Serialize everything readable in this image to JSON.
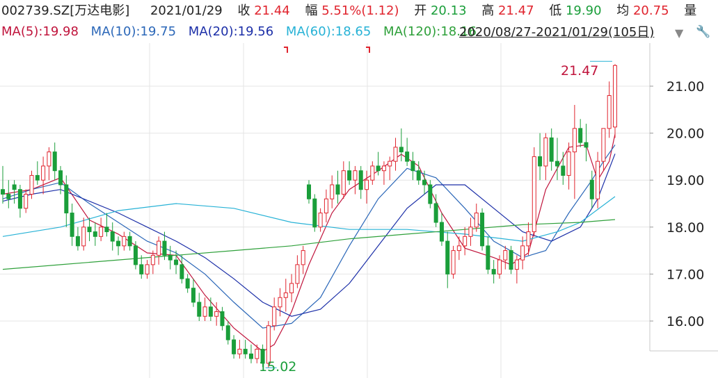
{
  "header": {
    "code": "002739.SZ[万达电影]",
    "date": "2021/01/29",
    "close_label": "收",
    "close_value": "21.44",
    "chg_label": "幅",
    "chg_value": "5.51%(1.12)",
    "open_label": "开",
    "open_value": "20.13",
    "high_label": "高",
    "high_value": "21.47",
    "low_label": "低",
    "low_value": "19.90",
    "avg_label": "均",
    "avg_value": "20.75",
    "vol_label": "量"
  },
  "ma_legend": [
    {
      "label": "MA(5): ",
      "value": "19.98",
      "color": "#c0143c"
    },
    {
      "label": "MA(10): ",
      "value": "19.75",
      "color": "#2b67b8"
    },
    {
      "label": "MA(20): ",
      "value": "19.56",
      "color": "#1c2fa8"
    },
    {
      "label": "MA(60): ",
      "value": "18.65",
      "color": "#27b2d6"
    },
    {
      "label": "MA(120): ",
      "value": "18.16",
      "color": "#2ea03a"
    }
  ],
  "range_text": "2020/08/27-2021/01/29(105日)",
  "chart_data": {
    "type": "candlestick",
    "y_ticks": [
      "21.00",
      "20.00",
      "19.00",
      "18.00",
      "17.00",
      "16.00"
    ],
    "ylim": [
      14.8,
      22.0
    ],
    "annotations": {
      "high_label": "21.47",
      "low_label": "15.02"
    },
    "colors": {
      "up": "#e0242e",
      "down": "#1a9e3a"
    },
    "ohlc": [
      [
        18.8,
        19.3,
        18.5,
        18.7
      ],
      [
        18.7,
        19.0,
        18.4,
        18.6
      ],
      [
        18.9,
        19.0,
        18.5,
        18.8
      ],
      [
        18.8,
        18.9,
        18.2,
        18.4
      ],
      [
        18.4,
        18.8,
        18.3,
        18.7
      ],
      [
        18.7,
        19.2,
        18.6,
        19.1
      ],
      [
        19.1,
        19.4,
        18.9,
        19.0
      ],
      [
        19.0,
        19.5,
        18.7,
        19.3
      ],
      [
        19.3,
        19.7,
        19.0,
        19.6
      ],
      [
        19.6,
        19.8,
        19.0,
        19.2
      ],
      [
        19.2,
        19.3,
        18.7,
        18.9
      ],
      [
        18.9,
        19.1,
        18.0,
        18.3
      ],
      [
        18.3,
        18.5,
        17.6,
        17.8
      ],
      [
        17.8,
        18.0,
        17.5,
        17.6
      ],
      [
        17.6,
        18.2,
        17.5,
        18.0
      ],
      [
        18.0,
        18.2,
        17.7,
        17.9
      ],
      [
        17.9,
        18.1,
        17.6,
        17.8
      ],
      [
        17.8,
        18.2,
        17.7,
        18.0
      ],
      [
        18.0,
        18.3,
        17.8,
        17.9
      ],
      [
        17.9,
        18.1,
        17.5,
        17.7
      ],
      [
        17.7,
        17.8,
        17.4,
        17.6
      ],
      [
        17.6,
        17.9,
        17.5,
        17.8
      ],
      [
        17.8,
        17.9,
        17.5,
        17.6
      ],
      [
        17.6,
        17.7,
        17.1,
        17.2
      ],
      [
        17.2,
        17.4,
        16.9,
        17.0
      ],
      [
        17.0,
        17.3,
        16.9,
        17.2
      ],
      [
        17.2,
        17.5,
        17.0,
        17.4
      ],
      [
        17.4,
        17.8,
        17.2,
        17.7
      ],
      [
        17.7,
        17.9,
        17.3,
        17.4
      ],
      [
        17.4,
        17.6,
        17.1,
        17.3
      ],
      [
        17.3,
        17.5,
        17.0,
        17.2
      ],
      [
        17.2,
        17.4,
        16.8,
        16.9
      ],
      [
        16.9,
        17.0,
        16.6,
        16.7
      ],
      [
        16.7,
        16.9,
        16.3,
        16.4
      ],
      [
        16.4,
        16.6,
        16.0,
        16.1
      ],
      [
        16.1,
        16.5,
        16.0,
        16.3
      ],
      [
        16.3,
        16.5,
        16.0,
        16.1
      ],
      [
        16.1,
        16.4,
        15.9,
        16.2
      ],
      [
        16.2,
        16.3,
        15.8,
        15.9
      ],
      [
        15.9,
        16.0,
        15.5,
        15.6
      ],
      [
        15.6,
        15.7,
        15.2,
        15.3
      ],
      [
        15.3,
        15.6,
        15.2,
        15.4
      ],
      [
        15.4,
        15.6,
        15.2,
        15.3
      ],
      [
        15.3,
        15.5,
        15.1,
        15.2
      ],
      [
        15.2,
        15.5,
        15.1,
        15.4
      ],
      [
        15.4,
        15.5,
        15.02,
        15.1
      ],
      [
        15.1,
        16.0,
        15.0,
        15.9
      ],
      [
        15.9,
        16.5,
        15.8,
        16.3
      ],
      [
        16.3,
        16.7,
        16.1,
        16.5
      ],
      [
        16.5,
        16.9,
        16.2,
        16.6
      ],
      [
        16.6,
        17.0,
        16.4,
        16.8
      ],
      [
        16.8,
        17.4,
        16.7,
        17.2
      ],
      [
        17.2,
        17.6,
        17.0,
        17.5
      ],
      [
        18.9,
        19.0,
        18.5,
        18.6
      ],
      [
        18.6,
        18.7,
        17.9,
        18.0
      ],
      [
        18.0,
        18.4,
        17.9,
        18.3
      ],
      [
        18.3,
        18.8,
        18.1,
        18.6
      ],
      [
        18.6,
        19.1,
        18.4,
        18.9
      ],
      [
        18.9,
        19.2,
        18.5,
        18.7
      ],
      [
        18.7,
        19.4,
        18.6,
        19.2
      ],
      [
        19.2,
        19.4,
        18.9,
        19.0
      ],
      [
        19.0,
        19.3,
        18.7,
        19.2
      ],
      [
        19.2,
        19.3,
        18.6,
        18.8
      ],
      [
        18.8,
        19.2,
        18.5,
        19.0
      ],
      [
        19.0,
        19.4,
        18.9,
        19.3
      ],
      [
        19.3,
        19.6,
        19.1,
        19.2
      ],
      [
        19.2,
        19.4,
        18.9,
        19.3
      ],
      [
        19.3,
        19.5,
        19.0,
        19.4
      ],
      [
        19.4,
        19.9,
        19.2,
        19.7
      ],
      [
        19.7,
        20.1,
        19.4,
        19.6
      ],
      [
        19.6,
        19.9,
        19.3,
        19.4
      ],
      [
        19.4,
        19.6,
        19.0,
        19.2
      ],
      [
        19.2,
        19.4,
        18.9,
        19.0
      ],
      [
        19.0,
        19.2,
        18.7,
        18.9
      ],
      [
        18.9,
        19.0,
        18.4,
        18.5
      ],
      [
        18.5,
        18.7,
        18.0,
        18.1
      ],
      [
        18.1,
        18.3,
        17.6,
        17.7
      ],
      [
        17.7,
        17.9,
        16.7,
        17.0
      ],
      [
        17.0,
        17.6,
        16.9,
        17.5
      ],
      [
        17.5,
        17.8,
        17.3,
        17.6
      ],
      [
        17.6,
        18.0,
        17.4,
        17.8
      ],
      [
        17.8,
        18.2,
        17.6,
        18.0
      ],
      [
        18.0,
        18.5,
        17.9,
        18.3
      ],
      [
        18.3,
        18.4,
        17.5,
        17.6
      ],
      [
        17.6,
        17.8,
        17.0,
        17.1
      ],
      [
        17.1,
        17.3,
        16.8,
        17.0
      ],
      [
        17.0,
        17.4,
        16.9,
        17.3
      ],
      [
        17.3,
        17.6,
        17.1,
        17.5
      ],
      [
        17.5,
        17.6,
        17.0,
        17.1
      ],
      [
        17.1,
        17.4,
        16.8,
        17.3
      ],
      [
        17.3,
        17.8,
        17.1,
        17.6
      ],
      [
        17.6,
        18.1,
        17.4,
        17.9
      ],
      [
        17.9,
        19.7,
        17.8,
        19.5
      ],
      [
        19.5,
        20.0,
        19.0,
        19.3
      ],
      [
        19.3,
        20.0,
        19.0,
        19.9
      ],
      [
        19.9,
        20.1,
        19.2,
        19.4
      ],
      [
        19.4,
        19.9,
        19.0,
        19.3
      ],
      [
        19.3,
        19.6,
        18.9,
        19.1
      ],
      [
        19.1,
        19.8,
        18.8,
        19.6
      ],
      [
        19.6,
        20.6,
        18.6,
        20.1
      ],
      [
        20.1,
        20.3,
        19.7,
        19.8
      ],
      [
        19.8,
        20.2,
        19.4,
        19.7
      ],
      [
        19.0,
        19.2,
        18.4,
        18.6
      ],
      [
        18.6,
        19.6,
        18.4,
        19.4
      ],
      [
        19.4,
        20.0,
        19.2,
        20.1
      ],
      [
        20.1,
        21.1,
        19.9,
        20.8
      ],
      [
        20.13,
        21.47,
        19.9,
        21.44
      ]
    ],
    "ma": [
      {
        "name": "MA5",
        "color": "#c0143c",
        "values": [
          [
            0,
            18.7
          ],
          [
            5,
            18.8
          ],
          [
            10,
            19.05
          ],
          [
            15,
            18.15
          ],
          [
            20,
            17.85
          ],
          [
            25,
            17.45
          ],
          [
            30,
            17.4
          ],
          [
            35,
            16.55
          ],
          [
            40,
            15.85
          ],
          [
            45,
            15.35
          ],
          [
            47,
            15.5
          ],
          [
            50,
            16.2
          ],
          [
            53,
            17.2
          ],
          [
            57,
            18.3
          ],
          [
            60,
            18.8
          ],
          [
            65,
            19.2
          ],
          [
            69,
            19.55
          ],
          [
            72,
            19.3
          ],
          [
            76,
            18.3
          ],
          [
            80,
            17.55
          ],
          [
            85,
            17.35
          ],
          [
            88,
            17.2
          ],
          [
            91,
            17.45
          ],
          [
            94,
            18.8
          ],
          [
            98,
            19.7
          ],
          [
            101,
            19.75
          ],
          [
            103,
            19.0
          ],
          [
            105,
            19.4
          ],
          [
            106,
            19.98
          ]
        ]
      },
      {
        "name": "MA10",
        "color": "#2b67b8",
        "values": [
          [
            0,
            18.6
          ],
          [
            5,
            18.8
          ],
          [
            10,
            18.95
          ],
          [
            15,
            18.5
          ],
          [
            20,
            18.1
          ],
          [
            25,
            17.7
          ],
          [
            30,
            17.45
          ],
          [
            35,
            17.0
          ],
          [
            40,
            16.4
          ],
          [
            45,
            15.85
          ],
          [
            50,
            15.95
          ],
          [
            55,
            16.5
          ],
          [
            60,
            17.6
          ],
          [
            65,
            18.6
          ],
          [
            70,
            19.25
          ],
          [
            75,
            19.05
          ],
          [
            80,
            18.4
          ],
          [
            85,
            17.7
          ],
          [
            90,
            17.35
          ],
          [
            94,
            17.5
          ],
          [
            98,
            18.3
          ],
          [
            102,
            19.0
          ],
          [
            104,
            19.4
          ],
          [
            106,
            19.75
          ]
        ]
      },
      {
        "name": "MA20",
        "color": "#1c2fa8",
        "values": [
          [
            0,
            18.55
          ],
          [
            5,
            18.7
          ],
          [
            10,
            18.8
          ],
          [
            15,
            18.55
          ],
          [
            20,
            18.3
          ],
          [
            25,
            18.0
          ],
          [
            30,
            17.7
          ],
          [
            35,
            17.35
          ],
          [
            40,
            16.9
          ],
          [
            45,
            16.4
          ],
          [
            50,
            16.1
          ],
          [
            55,
            16.25
          ],
          [
            60,
            16.8
          ],
          [
            65,
            17.6
          ],
          [
            70,
            18.4
          ],
          [
            75,
            18.9
          ],
          [
            80,
            18.9
          ],
          [
            85,
            18.4
          ],
          [
            90,
            17.9
          ],
          [
            95,
            17.7
          ],
          [
            100,
            18.0
          ],
          [
            103,
            18.6
          ],
          [
            106,
            19.56
          ]
        ]
      },
      {
        "name": "MA60",
        "color": "#27b2d6",
        "values": [
          [
            0,
            17.8
          ],
          [
            10,
            18.0
          ],
          [
            20,
            18.35
          ],
          [
            30,
            18.5
          ],
          [
            40,
            18.4
          ],
          [
            50,
            18.1
          ],
          [
            60,
            17.95
          ],
          [
            70,
            17.95
          ],
          [
            80,
            17.85
          ],
          [
            90,
            17.7
          ],
          [
            96,
            17.9
          ],
          [
            100,
            18.1
          ],
          [
            106,
            18.65
          ]
        ]
      },
      {
        "name": "MA120",
        "color": "#2ea03a",
        "values": [
          [
            0,
            17.1
          ],
          [
            10,
            17.2
          ],
          [
            20,
            17.3
          ],
          [
            30,
            17.4
          ],
          [
            40,
            17.5
          ],
          [
            50,
            17.6
          ],
          [
            60,
            17.75
          ],
          [
            70,
            17.85
          ],
          [
            80,
            17.95
          ],
          [
            90,
            18.05
          ],
          [
            100,
            18.1
          ],
          [
            106,
            18.16
          ]
        ]
      }
    ]
  }
}
